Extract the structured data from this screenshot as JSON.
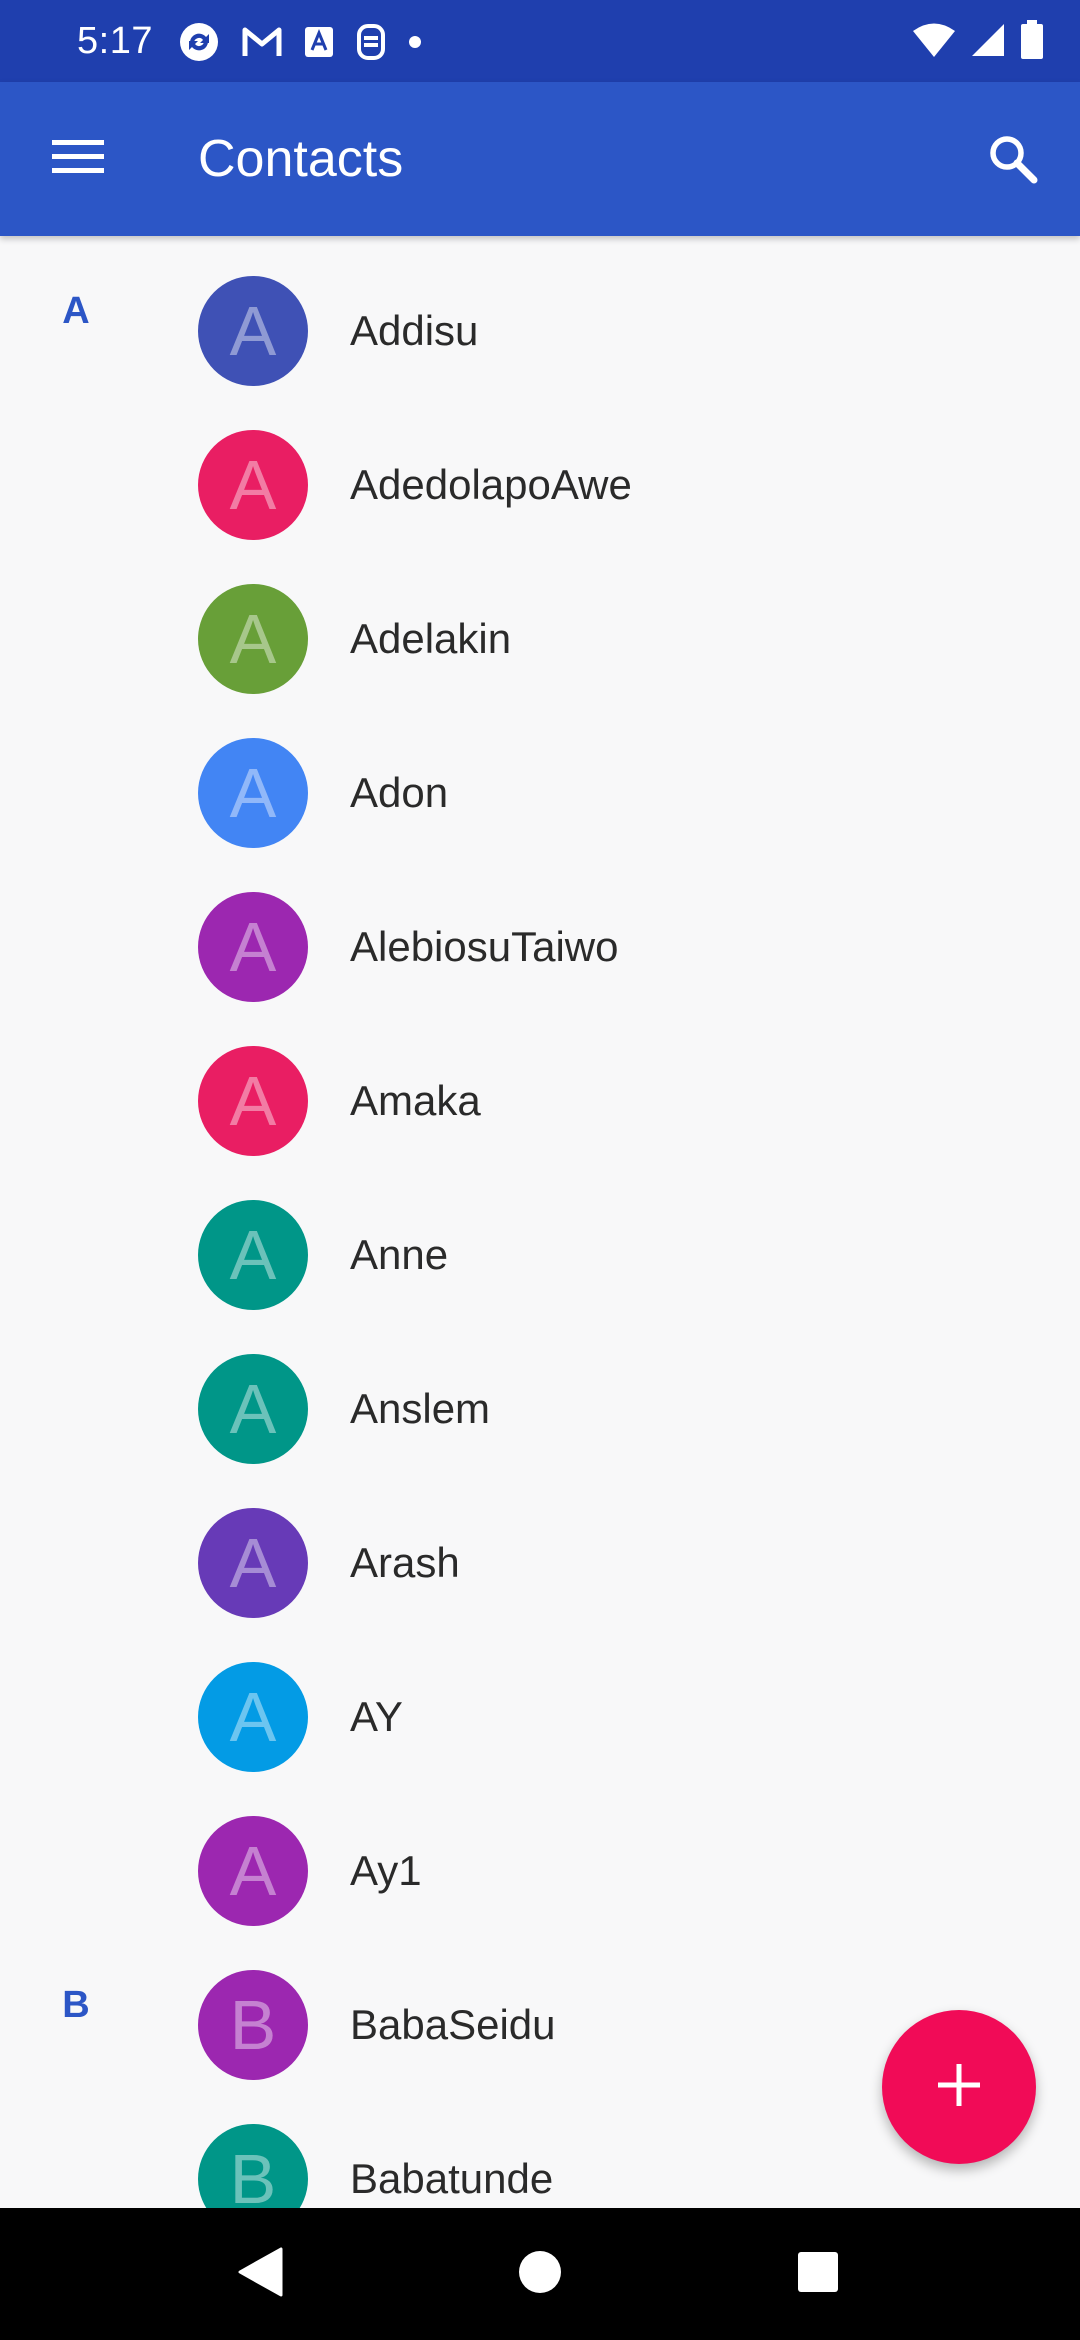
{
  "status_bar": {
    "time": "5:17",
    "left_icons": [
      "sync-icon",
      "gmail-icon",
      "text-a-icon",
      "sim-icon",
      "dot-icon"
    ],
    "right_icons": [
      "wifi-icon",
      "cell-signal-icon",
      "battery-icon"
    ]
  },
  "app_bar": {
    "title": "Contacts",
    "menu_icon": "menu-icon",
    "search_icon": "search-icon",
    "color": "#2c56c6"
  },
  "contacts": [
    {
      "section": "A",
      "initial": "A",
      "name": "Addisu",
      "color": "#3f51b5"
    },
    {
      "section": "",
      "initial": "A",
      "name": "AdedolapoAwe",
      "color": "#e91e63"
    },
    {
      "section": "",
      "initial": "A",
      "name": "Adelakin",
      "color": "#689f38"
    },
    {
      "section": "",
      "initial": "A",
      "name": "Adon",
      "color": "#4285f4"
    },
    {
      "section": "",
      "initial": "A",
      "name": "AlebiosuTaiwo",
      "color": "#9c27b0"
    },
    {
      "section": "",
      "initial": "A",
      "name": "Amaka",
      "color": "#e91e63"
    },
    {
      "section": "",
      "initial": "A",
      "name": "Anne",
      "color": "#009688"
    },
    {
      "section": "",
      "initial": "A",
      "name": "Anslem",
      "color": "#009688"
    },
    {
      "section": "",
      "initial": "A",
      "name": "Arash",
      "color": "#673ab7"
    },
    {
      "section": "",
      "initial": "A",
      "name": "AY",
      "color": "#039be5"
    },
    {
      "section": "",
      "initial": "A",
      "name": "Ay1",
      "color": "#9c27b0"
    },
    {
      "section": "B",
      "initial": "B",
      "name": "BabaSeidu",
      "color": "#9c27b0"
    },
    {
      "section": "",
      "initial": "B",
      "name": "Babatunde",
      "color": "#009688"
    }
  ],
  "fab": {
    "icon": "add-icon",
    "color": "#f10b57"
  },
  "nav_bar": {
    "icons": [
      "back-icon",
      "home-icon",
      "recents-icon"
    ]
  }
}
